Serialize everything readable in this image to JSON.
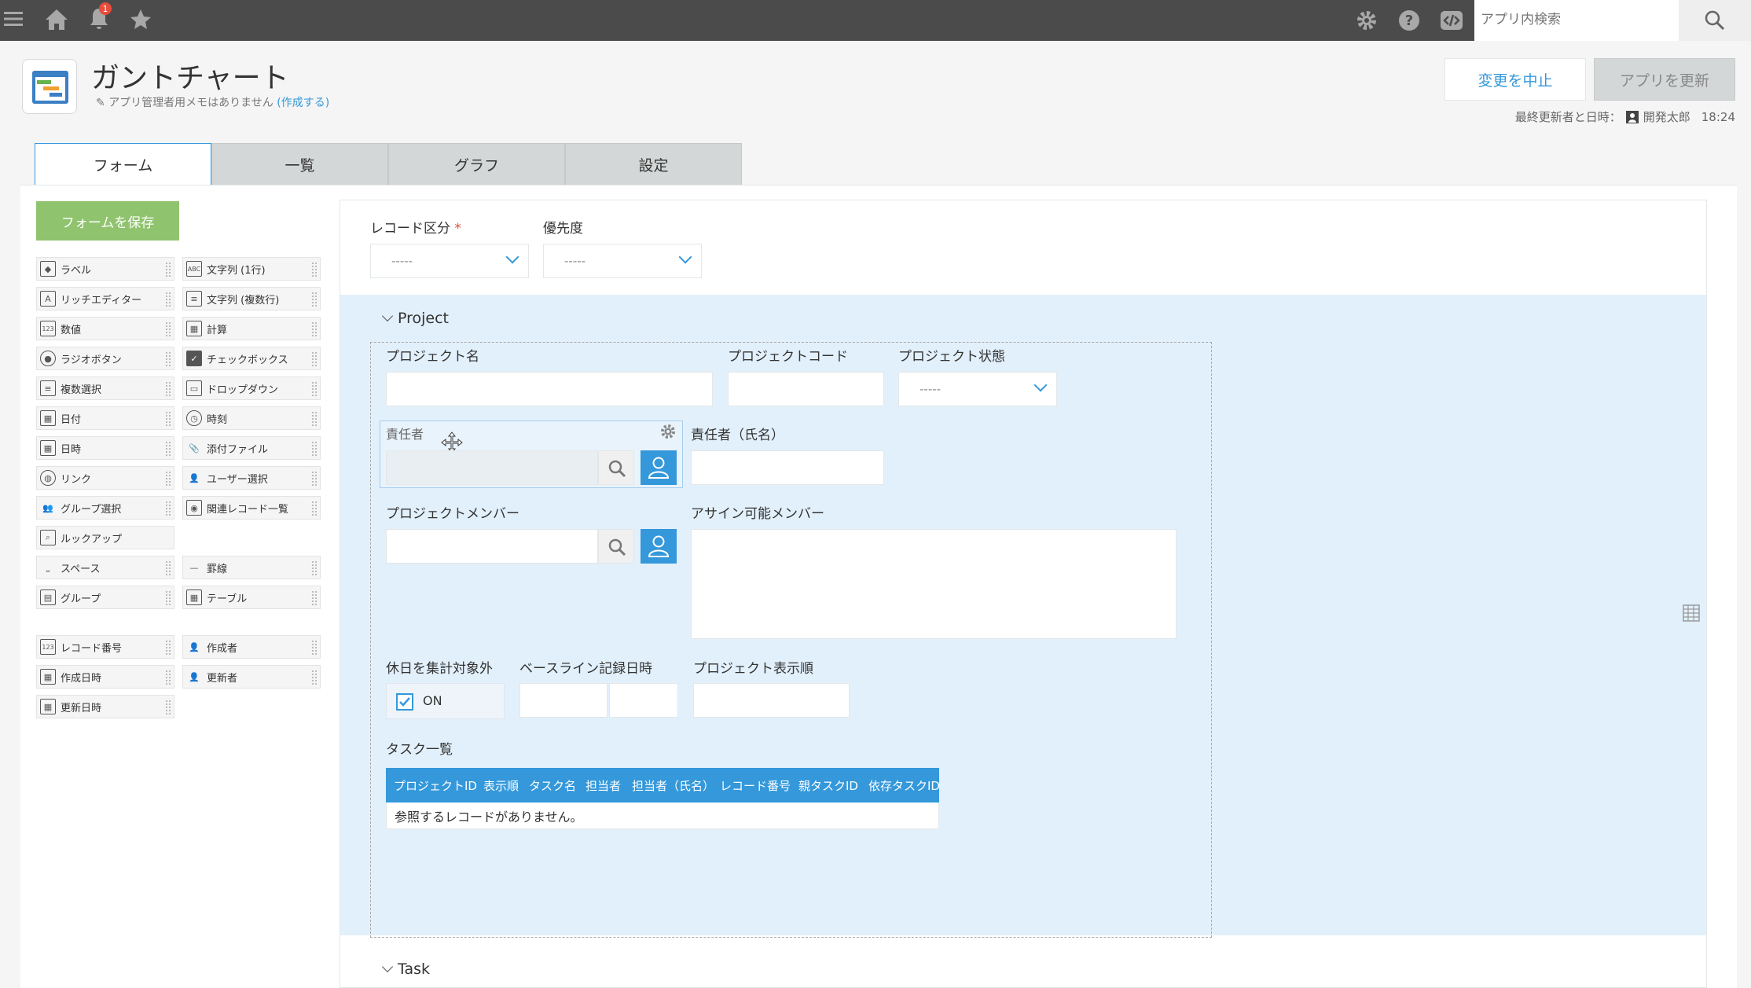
{
  "topbar": {
    "notification_count": "1",
    "search_placeholder": "アプリ内検索"
  },
  "header": {
    "app_title": "ガントチャート",
    "memo_text": "アプリ管理者用メモはありません",
    "memo_link": "(作成する)",
    "cancel_label": "変更を中止",
    "update_label": "アプリを更新",
    "last_update_label": "最終更新者と日時：",
    "last_update_user": "開発太郎",
    "last_update_time": "18:24"
  },
  "tabs": [
    "フォーム",
    "一覧",
    "グラフ",
    "設定"
  ],
  "palette": {
    "save_label": "フォームを保存",
    "left": [
      "ラベル",
      "リッチエディター",
      "数値",
      "ラジオボタン",
      "複数選択",
      "日付",
      "日時",
      "リンク",
      "グループ選択",
      "ルックアップ",
      "スペース",
      "グループ"
    ],
    "right": [
      "文字列 (1行)",
      "文字列 (複数行)",
      "計算",
      "チェックボックス",
      "ドロップダウン",
      "時刻",
      "添付ファイル",
      "ユーザー選択",
      "関連レコード一覧",
      "",
      "罫線",
      "テーブル"
    ],
    "system_left": [
      "レコード番号",
      "作成日時",
      "更新日時"
    ],
    "system_right": [
      "作成者",
      "更新者"
    ]
  },
  "form": {
    "record_kubun_label": "レコード区分",
    "priority_label": "優先度",
    "dropdown_empty": "-----",
    "project_group_label": "Project",
    "project_name_label": "プロジェクト名",
    "project_code_label": "プロジェクトコード",
    "project_status_label": "プロジェクト状態",
    "owner_label": "責任者",
    "owner_name_label": "責任者（氏名）",
    "member_label": "プロジェクトメンバー",
    "assignable_label": "アサイン可能メンバー",
    "holiday_label": "休日を集計対象外",
    "holiday_option": "ON",
    "baseline_label": "ベースライン記録日時",
    "display_order_label": "プロジェクト表示順",
    "task_list_label": "タスク一覧",
    "task_columns": [
      "プロジェクトID",
      "表示順",
      "タスク名",
      "担当者",
      "担当者（氏名）",
      "レコード番号",
      "親タスクID",
      "依存タスクID"
    ],
    "task_empty": "参照するレコードがありません。",
    "task_group_label": "Task"
  }
}
